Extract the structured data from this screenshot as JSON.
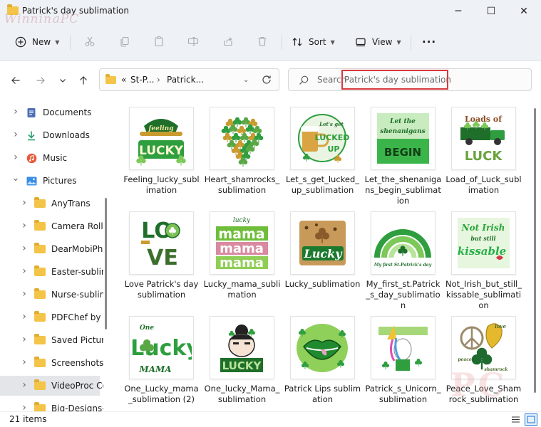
{
  "window": {
    "title": "Patrick's day sublimation",
    "watermark": "WinningPC",
    "controls": {
      "minimize": "─",
      "maximize": "☐",
      "close": "✕"
    }
  },
  "toolbar": {
    "new_label": "New",
    "sort_label": "Sort",
    "view_label": "View",
    "more_label": "···"
  },
  "address": {
    "chevrons": "«",
    "segments": [
      "St-P...",
      "Patrick..."
    ],
    "separator": "›"
  },
  "search": {
    "label": "Search",
    "value": "Patrick's day sublimation",
    "highlight_color": "#d9393d"
  },
  "sidebar": {
    "items": [
      {
        "label": "Documents",
        "icon": "documents-icon",
        "level": 1
      },
      {
        "label": "Downloads",
        "icon": "downloads-icon",
        "level": 1
      },
      {
        "label": "Music",
        "icon": "music-icon",
        "level": 1
      },
      {
        "label": "Pictures",
        "icon": "pictures-icon",
        "level": 1,
        "expanded": true
      },
      {
        "label": "AnyTrans",
        "icon": "folder-icon",
        "level": 2
      },
      {
        "label": "Camera Roll",
        "icon": "folder-icon",
        "level": 2
      },
      {
        "label": "DearMobiPho",
        "icon": "folder-icon",
        "level": 2
      },
      {
        "label": "Easter-sublim",
        "icon": "folder-icon",
        "level": 2
      },
      {
        "label": "Nurse-sublim",
        "icon": "folder-icon",
        "level": 2
      },
      {
        "label": "PDFChef by M",
        "icon": "folder-icon",
        "level": 2
      },
      {
        "label": "Saved Picture",
        "icon": "folder-icon",
        "level": 2
      },
      {
        "label": "Screenshots",
        "icon": "folder-icon",
        "level": 2
      },
      {
        "label": "VideoProc Co",
        "icon": "folder-icon",
        "level": 2,
        "selected": true
      },
      {
        "label": "Big-Designs-B",
        "icon": "folder-icon",
        "level": 2
      }
    ]
  },
  "files": [
    {
      "name": "Feeling_lucky_sublimation",
      "art": "lucky-hat"
    },
    {
      "name": "Heart_shamrocks_sublimation",
      "art": "heart-shamrocks"
    },
    {
      "name": "Let_s_get_lucked_up_sublimation",
      "art": "beer-mug"
    },
    {
      "name": "Let_the_shenanigans_begin_sublimation",
      "art": "shenanigans"
    },
    {
      "name": "Load_of_Luck_sublimation",
      "art": "truck"
    },
    {
      "name": "Love Patrick's day sublimation",
      "art": "love"
    },
    {
      "name": "Lucky_mama_sublimation",
      "art": "mama"
    },
    {
      "name": "Lucky_sublimation",
      "art": "lucky-leopard"
    },
    {
      "name": "My_first_st.Patrick_s_day_sublimation",
      "art": "rainbow"
    },
    {
      "name": "Not_Irish_but_still_kissable_sublimation",
      "art": "kissable"
    },
    {
      "name": "One_Lucky_mama_sublimation (2)",
      "art": "one-lucky-mama"
    },
    {
      "name": "One_lucky_Mama_sublimation",
      "art": "bun-girl"
    },
    {
      "name": "Patrick Lips sublimation",
      "art": "lips"
    },
    {
      "name": "Patrick_s_Unicorn_sublimation",
      "art": "unicorn"
    },
    {
      "name": "Peace_Love_Shamrock_sublimation",
      "art": "peace-love"
    }
  ],
  "art_text": {
    "lucky": "LUCKY",
    "feeling": "feeling",
    "get": "Let's get",
    "lucked": "LUCKED",
    "up": "UP",
    "let": "Let the",
    "shenanigans": "shenanigans",
    "begin": "BEGIN",
    "loads": "Loads of",
    "luck": "LUCK",
    "lo": "LO",
    "ve": "VE",
    "lucky_small": "lucky",
    "mama": "mama",
    "lucky_script": "Lucky",
    "first": "My first St.Patrick's day",
    "not_irish": "Not Irish",
    "but_still": "but still",
    "kissable": "kissable",
    "one": "One",
    "lucky_tall": "Lucky",
    "mama_caps": "MAMA",
    "lucky_block": "LUCKY",
    "peace": "peace",
    "love": "love",
    "shamrock": "shamrock"
  },
  "status": {
    "count": "21 items"
  },
  "colors": {
    "green": "#2e9e3e",
    "dark_green": "#1f6f2a",
    "gold": "#c99a2e",
    "accent": "#2b7bd8"
  }
}
